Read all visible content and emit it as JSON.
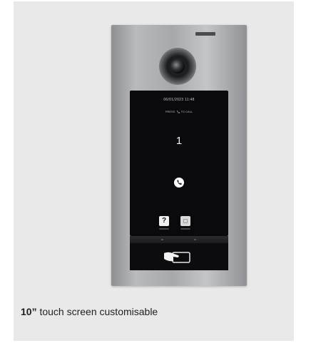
{
  "screen": {
    "datetime": "06/01/2023  11:48",
    "press_prefix": "PRESS",
    "press_suffix": "TO CALL",
    "number": "1"
  },
  "buttons": {
    "help_label": "?"
  },
  "caption": {
    "bold": "10”",
    "text": " touch screen customisable"
  },
  "icons": {
    "camera": "camera-icon",
    "call": "phone-icon",
    "help": "question-icon",
    "apps": "apps-icon",
    "card_reader": "card-reader-icon"
  }
}
